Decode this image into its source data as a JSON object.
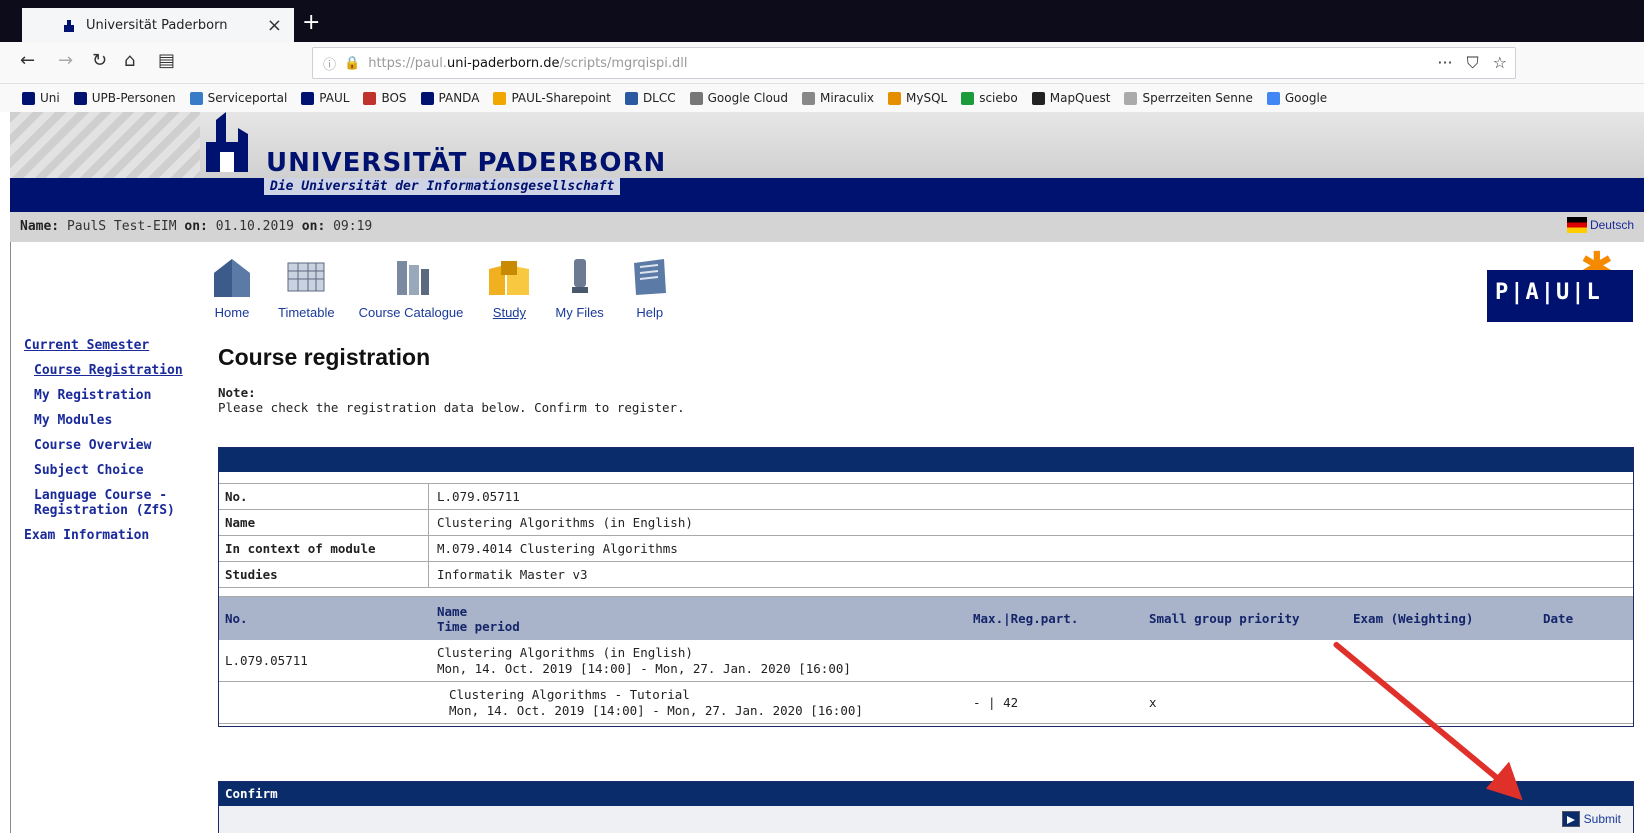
{
  "browser": {
    "tab_title": "Universität Paderborn",
    "tab_close": "×",
    "new_tab": "+",
    "url_prefix": "https://paul.",
    "url_domain": "uni-paderborn.de",
    "url_path": "/scripts/mgrqispi.dll",
    "more": "···",
    "bookmarks": [
      {
        "label": "Uni",
        "color": "#00126f"
      },
      {
        "label": "UPB-Personen",
        "color": "#00126f"
      },
      {
        "label": "Serviceportal",
        "color": "#3a7bc8"
      },
      {
        "label": "PAUL",
        "color": "#00126f"
      },
      {
        "label": "BOS",
        "color": "#c0322c"
      },
      {
        "label": "PANDA",
        "color": "#00126f"
      },
      {
        "label": "PAUL-Sharepoint",
        "color": "#f0a800"
      },
      {
        "label": "DLCC",
        "color": "#2c5aa0"
      },
      {
        "label": "Google Cloud",
        "color": "#777777"
      },
      {
        "label": "Miraculix",
        "color": "#888888"
      },
      {
        "label": "MySQL",
        "color": "#e48e00"
      },
      {
        "label": "sciebo",
        "color": "#1b9b3a"
      },
      {
        "label": "MapQuest",
        "color": "#222222"
      },
      {
        "label": "Sperrzeiten Senne",
        "color": "#aaaaaa"
      },
      {
        "label": "Google",
        "color": "#4285f4"
      }
    ]
  },
  "header": {
    "uni_name": "UNIVERSITÄT PADERBORN",
    "tagline": "Die Universität der Informationsgesellschaft",
    "brand_blue": "#00126f"
  },
  "status": {
    "name_label": "Name:",
    "name_value": "PaulS Test-EIM",
    "on_label1": "on:",
    "date": "01.10.2019",
    "on_label2": "on:",
    "time": "09:19",
    "language": "Deutsch"
  },
  "nav": [
    {
      "label": "Home"
    },
    {
      "label": "Timetable"
    },
    {
      "label": "Course Catalogue"
    },
    {
      "label": "Study"
    },
    {
      "label": "My Files"
    },
    {
      "label": "Help"
    }
  ],
  "paul_logo": "P|A|U|L",
  "sidebar": {
    "current_semester": "Current Semester",
    "items": [
      "Course Registration",
      "My Registration",
      "My Modules",
      "Course Overview",
      "Subject Choice",
      "Language Course - Registration (ZfS)"
    ],
    "exam_information": "Exam Information"
  },
  "main": {
    "title": "Course registration",
    "note_label": "Note:",
    "note_text": "Please check the registration data below. Confirm to register.",
    "details": [
      {
        "key": "No.",
        "value": "L.079.05711"
      },
      {
        "key": "Name",
        "value": "Clustering Algorithms (in English)"
      },
      {
        "key": "In context of module",
        "value": "M.079.4014 Clustering Algorithms"
      },
      {
        "key": "Studies",
        "value": "Informatik Master v3"
      }
    ],
    "table_headers": {
      "no": "No.",
      "name": "Name",
      "time_period": "Time period",
      "max_reg": "Max.|Reg.part.",
      "small_group": "Small group priority",
      "exam": "Exam (Weighting)",
      "date": "Date"
    },
    "rows": [
      {
        "no": "L.079.05711",
        "name": "Clustering Algorithms (in English)",
        "period": "Mon, 14. Oct. 2019 [14:00] - Mon, 27. Jan. 2020 [16:00]",
        "max_reg": "",
        "small_group": ""
      },
      {
        "no": "",
        "name": "Clustering Algorithms - Tutorial",
        "period": "Mon, 14. Oct. 2019 [14:00] - Mon, 27. Jan. 2020 [16:00]",
        "max_reg": "- | 42",
        "small_group": "x"
      }
    ],
    "confirm_title": "Confirm",
    "submit_label": "Submit"
  }
}
